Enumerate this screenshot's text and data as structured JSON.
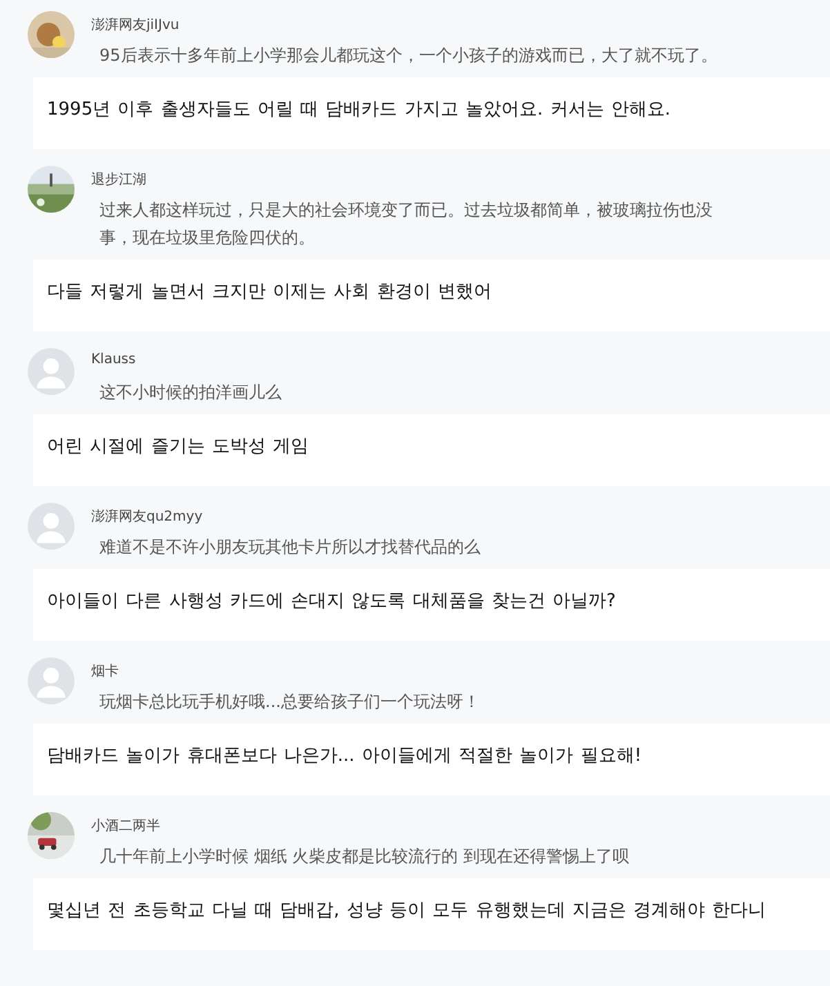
{
  "comments": [
    {
      "user": "澎湃网友jiIJvu",
      "text": "95后表示十多年前上小学那会儿都玩这个，一个小孩子的游戏而已，大了就不玩了。",
      "translation": "1995년 이후 출생자들도 어릴 때 담배카드 가지고 놀았어요. 커서는 안해요."
    },
    {
      "user": "退步江湖",
      "text": "过来人都这样玩过，只是大的社会环境变了而已。过去垃圾都简单，被玻璃拉伤也没事，现在垃圾里危险四伏的。",
      "translation": "다들 저렇게 놀면서 크지만 이제는 사회 환경이 변했어"
    },
    {
      "user": "Klauss",
      "avatar": {
        "kind": "default"
      },
      "text": "这不小时候的拍洋画儿么",
      "translation": "어린 시절에 즐기는 도박성 게임"
    },
    {
      "user": "澎湃网友qu2myy",
      "avatar": {
        "kind": "default"
      },
      "text": "难道不是不许小朋友玩其他卡片所以才找替代品的么",
      "translation": "아이들이 다른 사행성 카드에 손대지 않도록 대체품을 찾는건 아닐까?"
    },
    {
      "user": "烟卡",
      "avatar": {
        "kind": "default"
      },
      "text": "玩烟卡总比玩手机好哦...总要给孩子们一个玩法呀！",
      "translation": "담배카드 놀이가 휴대폰보다 나은가... 아이들에게 적절한 놀이가 필요해!"
    },
    {
      "user": "小酒二两半",
      "text": "几十年前上小学时候 烟纸 火柴皮都是比较流行的 到现在还得警惕上了呗",
      "translation": "몇십년 전 초등학교 다닐 때 담배갑, 성냥 등이 모두 유행했는데 지금은 경계해야 한다니"
    }
  ]
}
